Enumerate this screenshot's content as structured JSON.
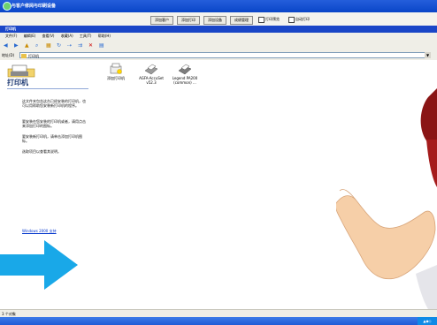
{
  "titlebar": {
    "title": "与客户修阅与印刷设备"
  },
  "top_buttons": [
    "添加客户",
    "添加打印",
    "添加设备",
    "成绩管理"
  ],
  "top_checks": [
    "打印预览",
    "自动打印"
  ],
  "window": {
    "title": "打印机"
  },
  "menu": [
    "文件(F)",
    "编辑(E)",
    "查看(V)",
    "收藏(A)",
    "工具(T)",
    "帮助(H)"
  ],
  "address": {
    "label": "地址(D)",
    "value": "打印机"
  },
  "leftpane": {
    "header": "打印机",
    "para1": "这文件夹包含这台已经安装的打印机，也可以用帮助您安装新打印机的程序。",
    "para2": "要安装在您安装的打印机或者，请用点击来添加打印的图标。",
    "para3": "要安装新打印机，请单击添加打印机图标。",
    "para4": "选取项目以查看其说明。",
    "link": "Windows 2000 支持"
  },
  "printers": [
    {
      "label": "添加打印机",
      "icon": "add-printer-icon"
    },
    {
      "label": "AGFA-AccuSet v52.3",
      "icon": "printer-icon"
    },
    {
      "label": "Legend PA200 (common) ...",
      "icon": "printer-icon"
    }
  ],
  "statusbar": {
    "text": "3 个对象"
  },
  "colors": {
    "arrow": "#19a8e8",
    "titlebar": "#1a4fd6"
  }
}
